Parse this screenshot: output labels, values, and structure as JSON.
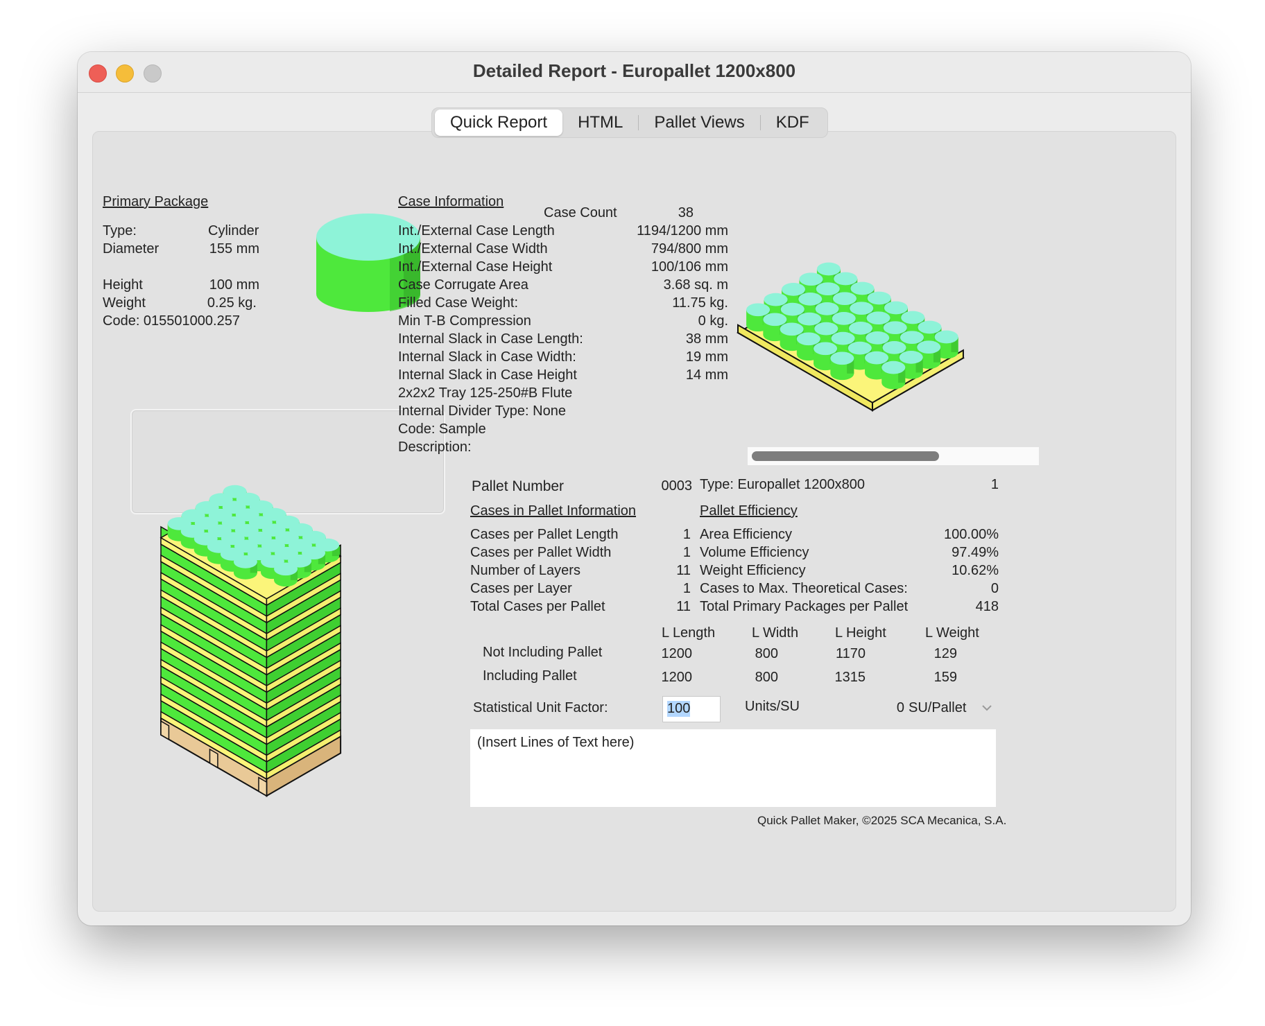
{
  "window": {
    "title": "Detailed Report - Europallet 1200x800"
  },
  "tabs": [
    "Quick Report",
    "HTML",
    "Pallet Views",
    "KDF"
  ],
  "primary": {
    "heading": "Primary Package",
    "type_label": "Type:",
    "type_value": "Cylinder",
    "diameter_label": "Diameter",
    "diameter_value": "155 mm",
    "height_label": "Height",
    "height_value": "100 mm",
    "weight_label": "Weight",
    "weight_value": "0.25 kg.",
    "code": "Code: 015501000.257"
  },
  "case": {
    "heading": "Case Information",
    "count_label": "Case Count",
    "count_value": "38",
    "rows": [
      {
        "label": "Int./External Case Length",
        "value": "1194/1200 mm"
      },
      {
        "label": "Int./External Case Width",
        "value": "794/800 mm"
      },
      {
        "label": "Int./External Case Height",
        "value": "100/106 mm"
      },
      {
        "label": "Case Corrugate Area",
        "value": "3.68 sq. m"
      },
      {
        "label": "Filled Case Weight:",
        "value": "11.75 kg."
      },
      {
        "label": "Min T-B Compression",
        "value": "0 kg."
      },
      {
        "label": "Internal Slack in Case Length:",
        "value": "38 mm"
      },
      {
        "label": "Internal Slack in Case Width:",
        "value": "19 mm"
      },
      {
        "label": "Internal Slack in Case Height",
        "value": "14 mm"
      }
    ],
    "extra": [
      "2x2x2 Tray 125-250#B Flute",
      "Internal Divider Type: None",
      "Code: Sample",
      "Description:"
    ]
  },
  "pallet": {
    "number_label": "Pallet Number",
    "number_value": "0003",
    "type": "Type: Europallet 1200x800",
    "type_count": "1"
  },
  "cases_in_pallet": {
    "heading": "Cases in Pallet Information",
    "rows": [
      {
        "label": "Cases per Pallet Length",
        "value": "1"
      },
      {
        "label": "Cases per Pallet Width",
        "value": "1"
      },
      {
        "label": "Number of Layers",
        "value": "11"
      },
      {
        "label": "Cases per Layer",
        "value": "1"
      },
      {
        "label": "Total Cases per Pallet",
        "value": "11"
      }
    ]
  },
  "efficiency": {
    "heading": "Pallet Efficiency",
    "rows": [
      {
        "label": "Area Efficiency",
        "value": "100.00%"
      },
      {
        "label": "Volume Efficiency",
        "value": "97.49%"
      },
      {
        "label": "Weight Efficiency",
        "value": "10.62%"
      },
      {
        "label": "Cases to Max. Theoretical Cases:",
        "value": "0"
      },
      {
        "label": "Total Primary Packages per Pallet",
        "value": "418"
      }
    ]
  },
  "dims": {
    "headers": [
      "L Length",
      "L Width",
      "L Height",
      "L Weight"
    ],
    "rows": [
      {
        "label": "Not Including Pallet",
        "values": [
          "1200",
          "800",
          "1170",
          "129"
        ]
      },
      {
        "label": "Including Pallet",
        "values": [
          "1200",
          "800",
          "1315",
          "159"
        ]
      }
    ]
  },
  "su": {
    "label": "Statistical Unit Factor:",
    "value": "100",
    "units_label": "Units/SU",
    "per_pallet": "0",
    "per_pallet_unit": "SU/Pallet"
  },
  "notes": {
    "text": "(Insert Lines of Text here)"
  },
  "footer": "Quick Pallet Maker, ©2025 SCA Mecanica, S.A.",
  "colors": {
    "cyl_top": "#8ef3d8",
    "cyl_side": "#4ee83c",
    "case_yellow": "#fbf57a",
    "pallet_wood": "#e9c997"
  },
  "icons": {
    "dropdown": "chevron-down-icon"
  }
}
